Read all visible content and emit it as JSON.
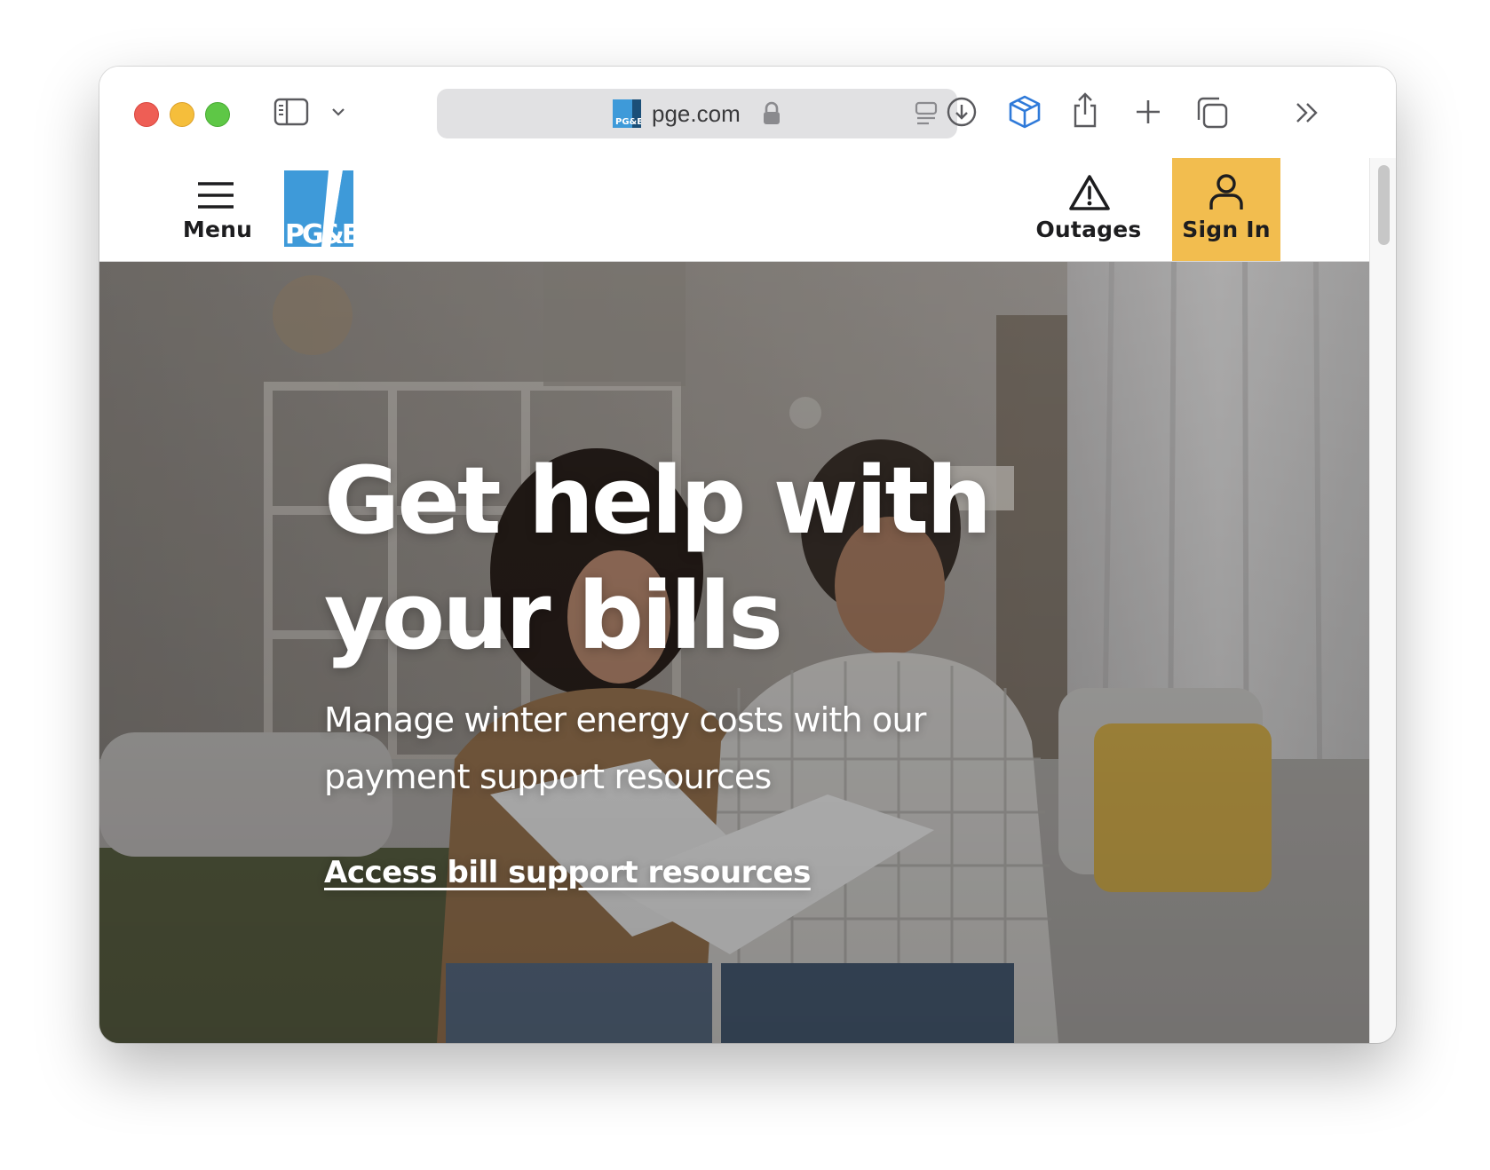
{
  "browser": {
    "address_bar": {
      "domain": "pge.com"
    },
    "icons": [
      "sidebar-icon",
      "chevron-down-icon",
      "download-icon",
      "extension-box-icon",
      "share-icon",
      "plus-icon",
      "tabs-overview-icon",
      "chevron-double-right-icon",
      "lock-icon",
      "reader-icon"
    ]
  },
  "site": {
    "header": {
      "menu_label": "Menu",
      "logo_text": "PG&E",
      "outages_label": "Outages",
      "signin_label": "Sign In"
    },
    "hero": {
      "title": "Get help with your bills",
      "subtitle": "Manage winter energy costs with our payment support resources",
      "link": "Access bill support resources"
    }
  },
  "colors": {
    "signin_bg": "#f2bd4f",
    "logo_blue": "#3e9ad9",
    "logo_orange": "#f2a93b"
  }
}
